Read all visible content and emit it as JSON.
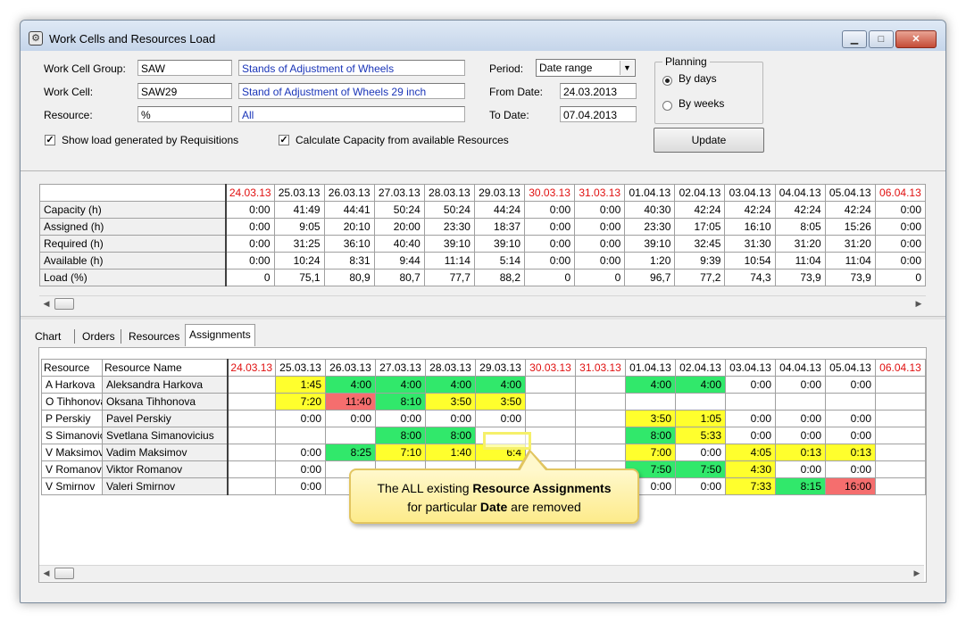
{
  "window": {
    "title": "Work Cells and Resources Load"
  },
  "form": {
    "work_cell_group_label": "Work Cell Group:",
    "work_cell_group_code": "SAW",
    "work_cell_group_name": "Stands of Adjustment of Wheels",
    "work_cell_label": "Work Cell:",
    "work_cell_code": "SAW29",
    "work_cell_name": "Stand of Adjustment of Wheels 29 inch",
    "resource_label": "Resource:",
    "resource_code": "%",
    "resource_name": "All",
    "period_label": "Period:",
    "period_value": "Date range",
    "from_label": "From Date:",
    "from_value": "24.03.2013",
    "to_label": "To Date:",
    "to_value": "07.04.2013",
    "planning_label": "Planning",
    "by_days": "By days",
    "by_weeks": "By weeks",
    "planning_selected": "By days",
    "show_load_label": "Show load generated by Requisitions",
    "show_load_checked": true,
    "calc_capacity_label": "Calculate Capacity from available Resources",
    "calc_capacity_checked": true,
    "update_label": "Update"
  },
  "dates": [
    {
      "label": "24.03.13",
      "weekend": true
    },
    {
      "label": "25.03.13",
      "weekend": false
    },
    {
      "label": "26.03.13",
      "weekend": false
    },
    {
      "label": "27.03.13",
      "weekend": false
    },
    {
      "label": "28.03.13",
      "weekend": false
    },
    {
      "label": "29.03.13",
      "weekend": false
    },
    {
      "label": "30.03.13",
      "weekend": true
    },
    {
      "label": "31.03.13",
      "weekend": true
    },
    {
      "label": "01.04.13",
      "weekend": false
    },
    {
      "label": "02.04.13",
      "weekend": false
    },
    {
      "label": "03.04.13",
      "weekend": false
    },
    {
      "label": "04.04.13",
      "weekend": false
    },
    {
      "label": "05.04.13",
      "weekend": false
    },
    {
      "label": "06.04.13",
      "weekend": true
    }
  ],
  "summary": [
    {
      "label": "Capacity (h)",
      "values": [
        "0:00",
        "41:49",
        "44:41",
        "50:24",
        "50:24",
        "44:24",
        "0:00",
        "0:00",
        "40:30",
        "42:24",
        "42:24",
        "42:24",
        "42:24",
        "0:00"
      ]
    },
    {
      "label": "Assigned (h)",
      "values": [
        "0:00",
        "9:05",
        "20:10",
        "20:00",
        "23:30",
        "18:37",
        "0:00",
        "0:00",
        "23:30",
        "17:05",
        "16:10",
        "8:05",
        "15:26",
        "0:00"
      ]
    },
    {
      "label": "Required (h)",
      "values": [
        "0:00",
        "31:25",
        "36:10",
        "40:40",
        "39:10",
        "39:10",
        "0:00",
        "0:00",
        "39:10",
        "32:45",
        "31:30",
        "31:20",
        "31:20",
        "0:00"
      ]
    },
    {
      "label": "Available (h)",
      "values": [
        "0:00",
        "10:24",
        "8:31",
        "9:44",
        "11:14",
        "5:14",
        "0:00",
        "0:00",
        "1:20",
        "9:39",
        "10:54",
        "11:04",
        "11:04",
        "0:00"
      ]
    },
    {
      "label": "Load (%)",
      "values": [
        "0",
        "75,1",
        "80,9",
        "80,7",
        "77,7",
        "88,2",
        "0",
        "0",
        "96,7",
        "77,2",
        "74,3",
        "73,9",
        "73,9",
        "0"
      ]
    }
  ],
  "tabs": [
    {
      "label": "Chart",
      "active": false
    },
    {
      "label": "Orders",
      "active": false
    },
    {
      "label": "Resources",
      "active": false
    },
    {
      "label": "Assignments",
      "active": true
    }
  ],
  "assignments": {
    "col_resource": "Resource",
    "col_name": "Resource Name",
    "rows": [
      {
        "code": "A Harkova",
        "name": "Aleksandra Harkova",
        "cells": [
          [
            "",
            ""
          ],
          [
            "1:45",
            "y"
          ],
          [
            "4:00",
            "g"
          ],
          [
            "4:00",
            "g"
          ],
          [
            "4:00",
            "g"
          ],
          [
            "4:00",
            "g"
          ],
          [
            "",
            ""
          ],
          [
            "",
            ""
          ],
          [
            "4:00",
            "g"
          ],
          [
            "4:00",
            "g"
          ],
          [
            "0:00",
            ""
          ],
          [
            "0:00",
            ""
          ],
          [
            "0:00",
            ""
          ],
          [
            "",
            ""
          ]
        ]
      },
      {
        "code": "O Tihhonova",
        "name": "Oksana Tihhonova",
        "cells": [
          [
            "",
            ""
          ],
          [
            "7:20",
            "y"
          ],
          [
            "11:40",
            "r"
          ],
          [
            "8:10",
            "g"
          ],
          [
            "3:50",
            "y"
          ],
          [
            "3:50",
            "y"
          ],
          [
            "",
            ""
          ],
          [
            "",
            ""
          ],
          [
            "",
            ""
          ],
          [
            "",
            ""
          ],
          [
            "",
            ""
          ],
          [
            "",
            ""
          ],
          [
            "",
            ""
          ],
          [
            "",
            ""
          ]
        ]
      },
      {
        "code": "P Perskiy",
        "name": "Pavel Perskiy",
        "cells": [
          [
            "",
            ""
          ],
          [
            "0:00",
            ""
          ],
          [
            "0:00",
            ""
          ],
          [
            "0:00",
            ""
          ],
          [
            "0:00",
            ""
          ],
          [
            "0:00",
            ""
          ],
          [
            "",
            ""
          ],
          [
            "",
            ""
          ],
          [
            "3:50",
            "y"
          ],
          [
            "1:05",
            "y"
          ],
          [
            "0:00",
            ""
          ],
          [
            "0:00",
            ""
          ],
          [
            "0:00",
            ""
          ],
          [
            "",
            ""
          ]
        ]
      },
      {
        "code": "S Simanovicius",
        "name": "Svetlana Simanovicius",
        "cells": [
          [
            "",
            ""
          ],
          [
            "",
            ""
          ],
          [
            "",
            ""
          ],
          [
            "8:00",
            "g"
          ],
          [
            "8:00",
            "g"
          ],
          [
            "",
            ""
          ],
          [
            "",
            ""
          ],
          [
            "",
            ""
          ],
          [
            "8:00",
            "g"
          ],
          [
            "5:33",
            "y"
          ],
          [
            "0:00",
            ""
          ],
          [
            "0:00",
            ""
          ],
          [
            "0:00",
            ""
          ],
          [
            "",
            ""
          ]
        ]
      },
      {
        "code": "V Maksimov",
        "name": "Vadim Maksimov",
        "cells": [
          [
            "",
            ""
          ],
          [
            "0:00",
            ""
          ],
          [
            "8:25",
            "g"
          ],
          [
            "7:10",
            "y"
          ],
          [
            "1:40",
            "y"
          ],
          [
            "6:4",
            "y"
          ],
          [
            "",
            ""
          ],
          [
            "",
            ""
          ],
          [
            "7:00",
            "y"
          ],
          [
            "0:00",
            ""
          ],
          [
            "4:05",
            "y"
          ],
          [
            "0:13",
            "y"
          ],
          [
            "0:13",
            "y"
          ],
          [
            "",
            ""
          ]
        ]
      },
      {
        "code": "V Romanov",
        "name": "Viktor Romanov",
        "cells": [
          [
            "",
            ""
          ],
          [
            "0:00",
            ""
          ],
          [
            "",
            ""
          ],
          [
            "",
            ""
          ],
          [
            "",
            ""
          ],
          [
            "",
            ""
          ],
          [
            "",
            ""
          ],
          [
            "",
            ""
          ],
          [
            "7:50",
            "g"
          ],
          [
            "7:50",
            "g"
          ],
          [
            "4:30",
            "y"
          ],
          [
            "0:00",
            ""
          ],
          [
            "0:00",
            ""
          ],
          [
            "",
            ""
          ]
        ]
      },
      {
        "code": "V Smirnov",
        "name": "Valeri Smirnov",
        "cells": [
          [
            "",
            ""
          ],
          [
            "0:00",
            ""
          ],
          [
            "",
            ""
          ],
          [
            "",
            ""
          ],
          [
            "",
            ""
          ],
          [
            "",
            ""
          ],
          [
            "",
            ""
          ],
          [
            "",
            ""
          ],
          [
            "0:00",
            ""
          ],
          [
            "0:00",
            ""
          ],
          [
            "7:33",
            "y"
          ],
          [
            "8:15",
            "g"
          ],
          [
            "16:00",
            "r"
          ],
          [
            "",
            ""
          ]
        ]
      }
    ]
  },
  "callout": {
    "line1_pre": "The ALL existing ",
    "line1_bold": "Resource Assignments",
    "line2_pre": "for particular ",
    "line2_bold": "Date",
    "line2_post": " are removed"
  },
  "colors": {
    "yellow": "#ffff2d",
    "green": "#31e86b",
    "red": "#f56e6e",
    "weekend_text": "#e01010"
  }
}
